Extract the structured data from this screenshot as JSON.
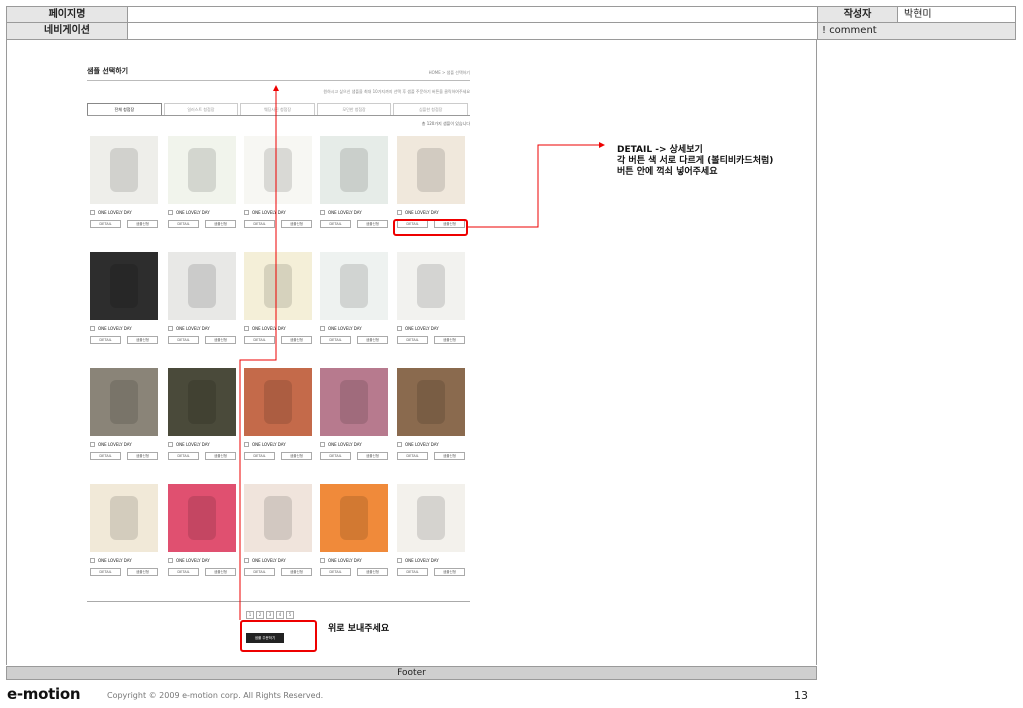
{
  "header": {
    "page_name_label": "페이지명",
    "page_name_value": "",
    "author_label": "작성자",
    "author_value": "박현미",
    "navigation_label": "네비게이션",
    "navigation_value": "",
    "comment_label": "! comment"
  },
  "mock_page": {
    "title": "샘플 선택하기",
    "breadcrumb": "HOME  >  샘플 선택하기",
    "description": "원하시고 싶으신 샘플을 최대 10가지까지 선택 후 샘플 주문하기 버튼을 클릭하여주세요",
    "tabs": [
      "전체 청첩장",
      "일러스트 청첩장",
      "웨딩사진 청첩장",
      "모던한 청첩장",
      "심플한 청첩장"
    ],
    "active_tab": 0,
    "count_text": "총 120가지 샘플이 있습니다",
    "product_caption": "ONE LOVELY DAY",
    "detail_label": "DETAIL",
    "sample_label": "샘플신청",
    "pages": [
      "1",
      "2",
      "3",
      "4",
      "5"
    ],
    "apply_button": "샘플 주문하기",
    "thumb_colors": [
      [
        "#eeeeea",
        "#f1f4ec",
        "#f7f7f3",
        "#e6ece8",
        "#f0e8dc"
      ],
      [
        "#2d2d2d",
        "#e8e8e6",
        "#f4efd8",
        "#eef2f0",
        "#f2f2ef"
      ],
      [
        "#8a8478",
        "#4a4a3a",
        "#c46a4a",
        "#b77a8e",
        "#8a6a4e"
      ],
      [
        "#f1e9d8",
        "#e05070",
        "#f0e4dc",
        "#f08a3a",
        "#f3f1ec"
      ]
    ]
  },
  "annotations": {
    "detail_note_line1": "DETAIL -> 상세보기",
    "detail_note_line2": "각 버튼 색 서로 다르게 (볼티비카드처럼)",
    "detail_note_line3": "버튼 안에 꺽쇠 넣어주세요",
    "move_up_note": "위로 보내주세요",
    "accent_color": "#e00000"
  },
  "footer": {
    "label": "Footer",
    "brand": "e-motion",
    "copyright": "Copyright © 2009 e-motion corp. All Rights Reserved.",
    "page_number": "13"
  }
}
